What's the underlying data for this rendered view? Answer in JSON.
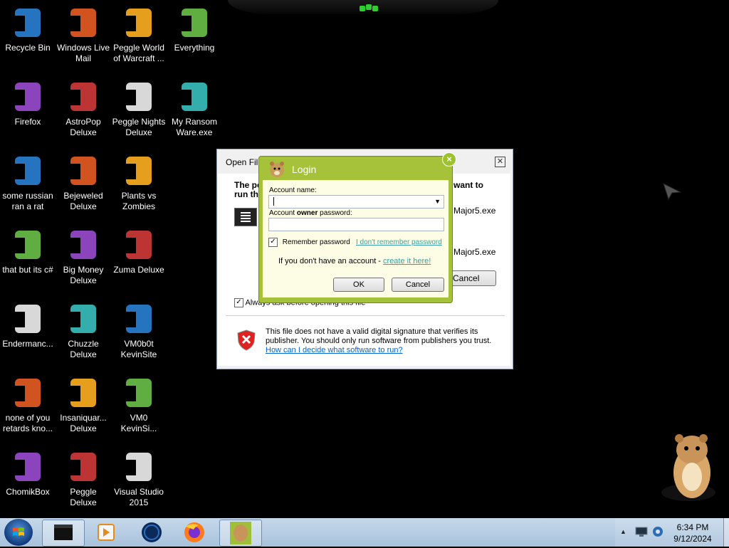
{
  "desktop": {
    "icons": [
      {
        "label": "Recycle Bin",
        "icon": "recycle-bin-icon"
      },
      {
        "label": "Windows Live Mail",
        "icon": "windows-live-mail-icon"
      },
      {
        "label": "Peggle World of Warcraft ...",
        "icon": "peggle-world-of-warcraft-icon"
      },
      {
        "label": "Everything",
        "icon": "everything-icon"
      },
      {
        "label": "Firefox",
        "icon": "firefox-icon"
      },
      {
        "label": "AstroPop Deluxe",
        "icon": "astropop-icon"
      },
      {
        "label": "Peggle Nights Deluxe",
        "icon": "peggle-nights-icon"
      },
      {
        "label": "My Ransom Ware.exe",
        "icon": "exe-icon"
      },
      {
        "label": "some russian ran a rat",
        "icon": "file-icon"
      },
      {
        "label": "Bejeweled Deluxe",
        "icon": "bejeweled-icon"
      },
      {
        "label": "Plants vs Zombies",
        "icon": "plants-vs-zombies-icon"
      },
      {
        "label": "that but its c#",
        "icon": "folder-icon"
      },
      {
        "label": "Big Money Deluxe",
        "icon": "big-money-icon"
      },
      {
        "label": "Zuma Deluxe",
        "icon": "zuma-icon"
      },
      {
        "label": "Endermanc...",
        "icon": "exe-icon"
      },
      {
        "label": "Chuzzle Deluxe",
        "icon": "chuzzle-icon"
      },
      {
        "label": "VM0b0t KevinSite",
        "icon": "vm-icon"
      },
      {
        "label": "none of you retards kno...",
        "icon": "file-icon"
      },
      {
        "label": "Insaniquar... Deluxe",
        "icon": "insaniquarium-icon"
      },
      {
        "label": "VM0 KevinSi...",
        "icon": "vm-icon"
      },
      {
        "label": "ChomikBox",
        "icon": "chomikbox-icon"
      },
      {
        "label": "Peggle Deluxe",
        "icon": "peggle-icon"
      },
      {
        "label": "Visual Studio 2015",
        "icon": "visual-studio-icon"
      }
    ]
  },
  "open_file": {
    "title": "Open File",
    "question_left": "The pe\nrun thi",
    "question_right": "want to",
    "exe1": "Major5.exe",
    "exe2": "Major5.exe",
    "cancel_label": "Cancel",
    "always_ask": "Always ask before opening this file",
    "warning_text": "This file does not have a valid digital signature that verifies its publisher.  You should only run software from publishers you trust.",
    "warning_link": "How can I decide what software to run?"
  },
  "login": {
    "title": "Login",
    "account_name_label": "Account name:",
    "account_name_value": "",
    "password_label_pre": "Account ",
    "password_label_bold": "owner",
    "password_label_post": " password:",
    "password_value": "",
    "remember_label": "Remember password",
    "remember_checked": "✓",
    "forgot_link": "I don't remember password",
    "no_account_text": "If you don't have an account - ",
    "create_link": "create it here!",
    "ok_label": "OK",
    "cancel_label": "Cancel",
    "close_glyph": "×",
    "accent": "#a6c23a"
  },
  "taskbar": {
    "time": "6:34 PM",
    "date": "9/12/2024",
    "pinned": [
      "terminal-icon",
      "media-player-icon",
      "globe-icon",
      "firefox-icon",
      "chomikbox-icon"
    ]
  }
}
